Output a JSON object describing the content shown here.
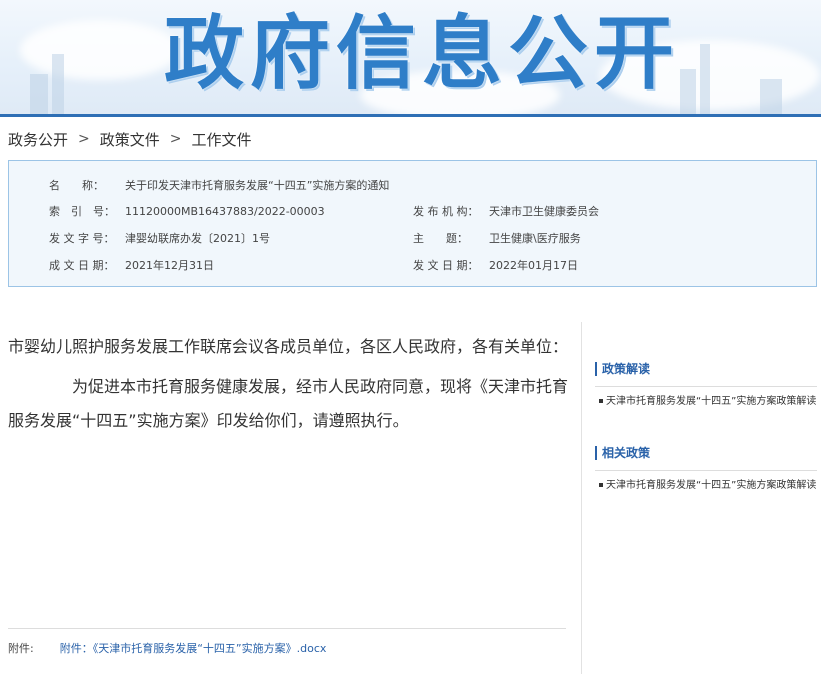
{
  "banner": {
    "title": "政府信息公开"
  },
  "breadcrumb": {
    "items": [
      "政务公开",
      "政策文件",
      "工作文件"
    ],
    "separator": ">"
  },
  "info": {
    "name_label": "名　　称：",
    "name_value": "关于印发天津市托育服务发展“十四五”实施方案的通知",
    "index_label": "索　引　号：",
    "index_value": "11120000MB16437883/2022-00003",
    "publisher_label": "发 布 机 构：",
    "publisher_value": "天津市卫生健康委员会",
    "doc_no_label": "发 文 字 号：",
    "doc_no_value": "津婴幼联席办发〔2021〕1号",
    "subject_label": "主　　题：",
    "subject_value": "卫生健康\\医疗服务",
    "written_date_label": "成 文 日 期：",
    "written_date_value": "2021年12月31日",
    "issue_date_label": "发 文 日 期：",
    "issue_date_value": "2022年01月17日"
  },
  "content": {
    "salutation": "市婴幼儿照护服务发展工作联席会议各成员单位，各区人民政府，各有关单位：",
    "body": "为促进本市托育服务健康发展，经市人民政府同意，现将《天津市托育服务发展“十四五”实施方案》印发给你们，请遵照执行。"
  },
  "attachment": {
    "label": "附件:",
    "link": "附件：《天津市托育服务发展“十四五”实施方案》.docx"
  },
  "sidebar": {
    "interpretation_title": "政策解读",
    "interpretation_item": "天津市托育服务发展“十四五”实施方案政策解读",
    "related_title": "相关政策",
    "related_item": "天津市托育服务发展“十四五”实施方案政策解读"
  },
  "colors": {
    "accent": "#2a62a9",
    "banner_title": "#2f7ec8",
    "info_border": "#9cc4e6",
    "info_bg": "#f1f7fc"
  }
}
